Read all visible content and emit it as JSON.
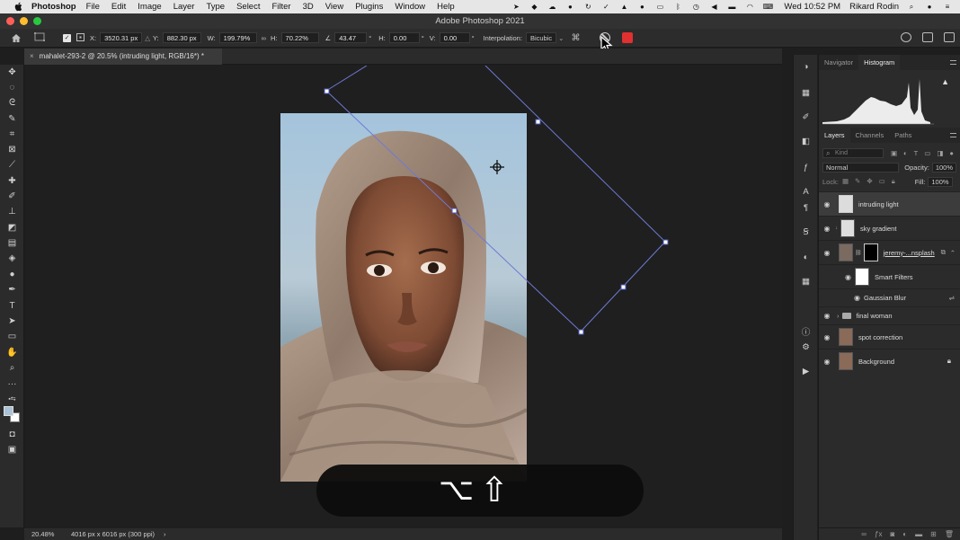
{
  "menubar": {
    "app_name": "Photoshop",
    "items": [
      "File",
      "Edit",
      "Image",
      "Layer",
      "Type",
      "Select",
      "Filter",
      "3D",
      "View",
      "Plugins",
      "Window",
      "Help"
    ],
    "clock": "Wed 10:52 PM",
    "user": "Rikard Rodin"
  },
  "window": {
    "title": "Adobe Photoshop 2021"
  },
  "options": {
    "x_label": "X:",
    "x_value": "3520.31 px",
    "y_label": "Y:",
    "y_value": "882.30 px",
    "w_label": "W:",
    "w_value": "199.79%",
    "h_label": "H:",
    "h_value": "70.22%",
    "angle_value": "43.47",
    "angle_unit": "°",
    "hskew_label": "H:",
    "hskew_value": "0.00",
    "vskew_label": "V:",
    "vskew_value": "0.00",
    "skew_unit": "°",
    "interpolation_label": "Interpolation:",
    "interpolation_value": "Bicubic"
  },
  "document": {
    "tab_title": "mahalet-293-2 @ 20.5% (intruding light, RGB/16*) *",
    "close_glyph": "×"
  },
  "status": {
    "zoom": "20.48%",
    "dimensions": "4016 px x 6016 px (300 ppi)",
    "arrow": "›"
  },
  "panels": {
    "top_tabs": [
      "Navigator",
      "Histogram"
    ],
    "active_top_tab": "Histogram",
    "layer_tabs": [
      "Layers",
      "Channels",
      "Paths"
    ],
    "active_layer_tab": "Layers",
    "search_placeholder": "Kind",
    "blend_mode": "Normal",
    "opacity_label": "Opacity:",
    "opacity_value": "100%",
    "lock_label": "Lock:",
    "fill_label": "Fill:",
    "fill_value": "100%"
  },
  "layers": [
    {
      "name": "intruding light",
      "selected": true
    },
    {
      "name": "sky gradient"
    },
    {
      "name": "jeremy-...nsplash"
    },
    {
      "name": "Smart Filters"
    },
    {
      "name": "Gaussian Blur"
    },
    {
      "name": "final woman"
    },
    {
      "name": "spot correction"
    },
    {
      "name": "Background"
    }
  ],
  "icons": {
    "apple": "apple-icon",
    "home": "home-icon",
    "commit": "commit-transform-icon",
    "cancel": "cancel-transform-icon"
  },
  "colors": {
    "commit_red": "#e03030",
    "bbox_blue": "#6d7ad6",
    "menubar_bg": "#e6e6e6"
  },
  "keys_overlay": [
    "⌥",
    "⇧"
  ]
}
